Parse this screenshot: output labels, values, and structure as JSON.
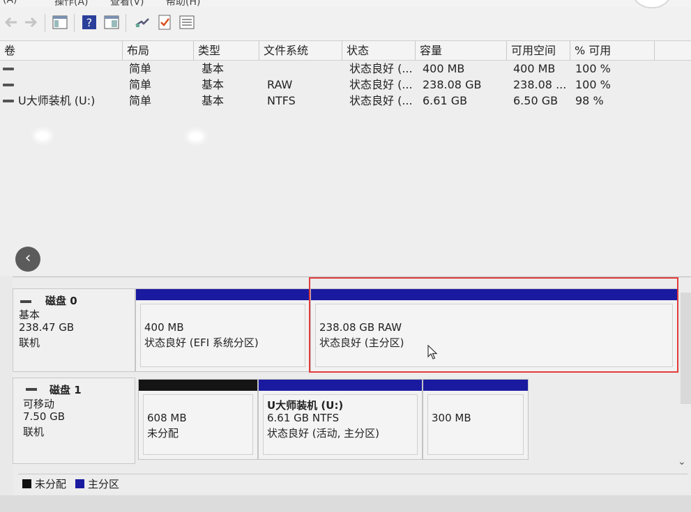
{
  "menu": [
    "(A)",
    "操作(A)",
    "查看(V)",
    "帮助(H)"
  ],
  "toolbar": {
    "icons": [
      "back-arrow-icon",
      "forward-arrow-icon",
      "console-tree-icon",
      "help-icon",
      "properties-icon",
      "connect-icon",
      "check-icon",
      "list-view-icon"
    ]
  },
  "columns": [
    "卷",
    "布局",
    "类型",
    "文件系统",
    "状态",
    "容量",
    "可用空间",
    "% 可用"
  ],
  "volumes": [
    {
      "name": "",
      "layout": "简单",
      "type": "基本",
      "fs": "",
      "status": "状态良好 (...",
      "capacity": "400 MB",
      "free": "400 MB",
      "pct": "100 %"
    },
    {
      "name": "",
      "layout": "简单",
      "type": "基本",
      "fs": "RAW",
      "status": "状态良好 (...",
      "capacity": "238.08 GB",
      "free": "238.08 ...",
      "pct": "100 %"
    },
    {
      "name": "U大师装机 (U:)",
      "layout": "简单",
      "type": "基本",
      "fs": "NTFS",
      "status": "状态良好 (...",
      "capacity": "6.61 GB",
      "free": "6.50 GB",
      "pct": "98 %"
    }
  ],
  "back_glyph": "‹",
  "disks": [
    {
      "name": "磁盘 0",
      "kind": "基本",
      "size": "238.47 GB",
      "state": "联机",
      "partitions": [
        {
          "line1": "400 MB",
          "line2": "状态良好 (EFI 系统分区)"
        },
        {
          "line1": "238.08 GB RAW",
          "line2": "状态良好 (主分区)"
        }
      ]
    },
    {
      "name": "磁盘 1",
      "kind": "可移动",
      "size": "7.50 GB",
      "state": "联机",
      "partitions": [
        {
          "line1": "608 MB",
          "line2": "未分配"
        },
        {
          "title": "U大师装机  (U:)",
          "line1": "6.61 GB NTFS",
          "line2": "状态良好 (活动, 主分区)"
        },
        {
          "line1": "300 MB"
        }
      ]
    }
  ],
  "legend": [
    {
      "label": "未分配",
      "color": "#111111"
    },
    {
      "label": "主分区",
      "color": "#1a1aa0"
    }
  ],
  "scroll_glyph": "⌄"
}
